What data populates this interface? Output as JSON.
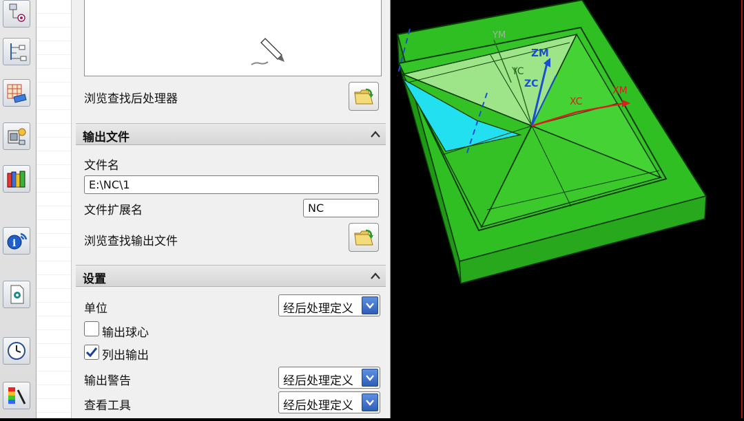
{
  "toolbar": {
    "tools": [
      {
        "name": "operation-navigator-icon"
      },
      {
        "name": "part-navigator-icon"
      },
      {
        "name": "machine-tool-icon"
      },
      {
        "name": "method-view-icon"
      },
      {
        "name": "library-books-icon"
      },
      {
        "name": "information-icon"
      },
      {
        "name": "document-icon"
      },
      {
        "name": "clock-icon"
      },
      {
        "name": "color-palette-icon"
      }
    ]
  },
  "postprocessor": {
    "browse_label": "浏览查找后处理器"
  },
  "output_file": {
    "section_title": "输出文件",
    "file_name_label": "文件名",
    "file_name_value": "E:\\NC\\1",
    "extension_label": "文件扩展名",
    "extension_value": "NC",
    "browse_label": "浏览查找输出文件"
  },
  "settings": {
    "section_title": "设置",
    "units_label": "单位",
    "units_value": "经后处理定义",
    "output_ball_center_label": "输出球心",
    "output_ball_center_checked": false,
    "list_output_label": "列出输出",
    "list_output_checked": true,
    "output_warning_label": "输出警告",
    "output_warning_value": "经后处理定义",
    "review_tool_label": "查看工具",
    "review_tool_value": "经后处理定义"
  },
  "viewport": {
    "axes": {
      "ym": "YM",
      "zm": "ZM",
      "yc": "YC",
      "zc": "ZC",
      "xc": "XC",
      "xm": "XM"
    },
    "colors": {
      "background": "#000000",
      "part": "#33cc22",
      "selected_face": "#22e0f0",
      "wcs_axis": "#1a4fd0",
      "mcs_axis": "#d82020"
    }
  }
}
